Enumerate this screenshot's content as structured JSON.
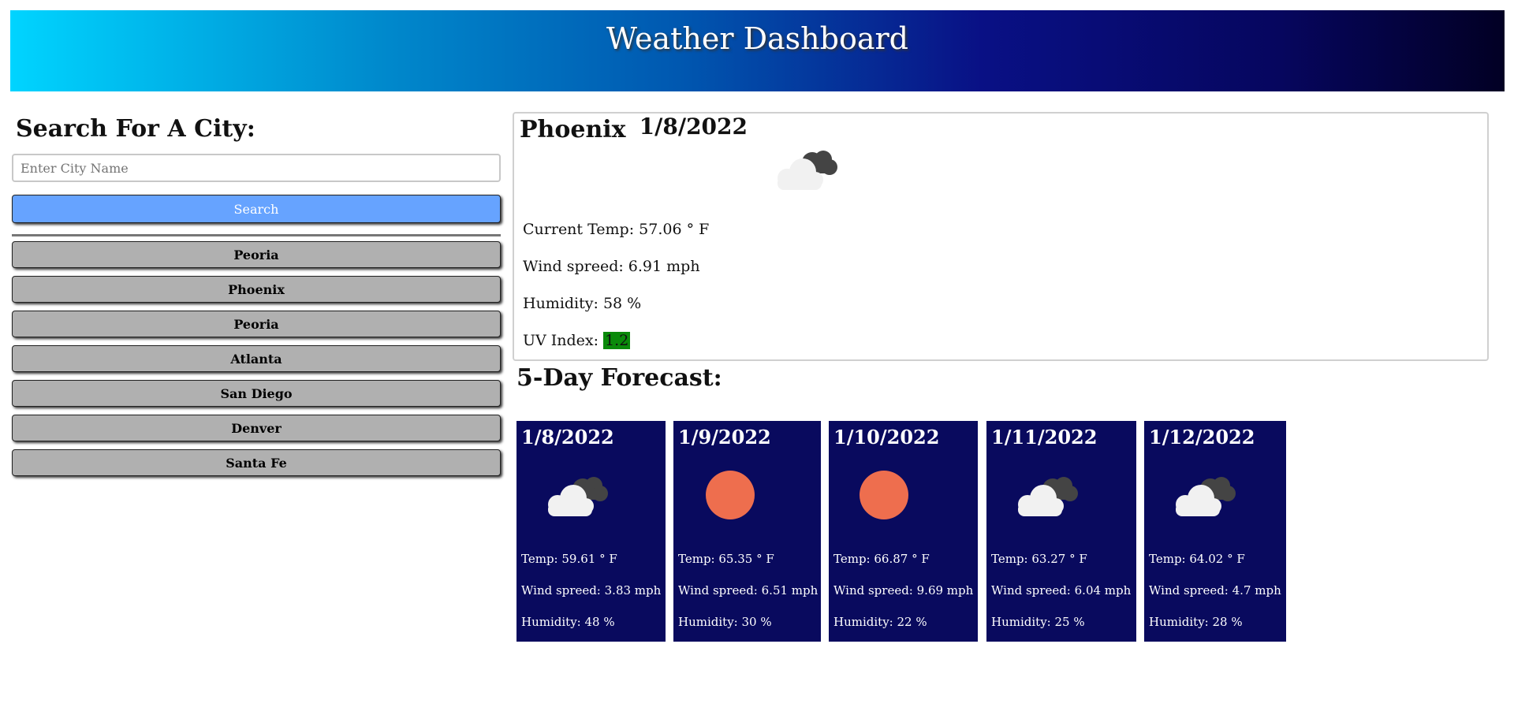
{
  "header": {
    "title": "Weather Dashboard"
  },
  "search": {
    "title": "Search For A City:",
    "placeholder": "Enter City Name",
    "value": "",
    "button_label": "Search"
  },
  "history": [
    "Peoria",
    "Phoenix",
    "Peoria",
    "Atlanta",
    "San Diego",
    "Denver",
    "Santa Fe"
  ],
  "current": {
    "city": "Phoenix",
    "date": "1/8/2022",
    "icon": "clouds-icon",
    "temp": "Current Temp: 57.06 ° F",
    "wind": "Wind spreed: 6.91 mph",
    "humidity": "Humidity: 58 %",
    "uv_label": "UV Index:",
    "uv_value": "1.2",
    "uv_color": "#0a8a0a"
  },
  "forecast": {
    "title": "5-Day Forecast:",
    "days": [
      {
        "date": "1/8/2022",
        "icon": "clouds-icon",
        "temp": "Temp: 59.61 ° F",
        "wind": "Wind spreed: 3.83 mph",
        "humidity": "Humidity: 48 %"
      },
      {
        "date": "1/9/2022",
        "icon": "sun-icon",
        "temp": "Temp: 65.35 ° F",
        "wind": "Wind spreed: 6.51 mph",
        "humidity": "Humidity: 30 %"
      },
      {
        "date": "1/10/2022",
        "icon": "sun-icon",
        "temp": "Temp: 66.87 ° F",
        "wind": "Wind spreed: 9.69 mph",
        "humidity": "Humidity: 22 %"
      },
      {
        "date": "1/11/2022",
        "icon": "clouds-icon",
        "temp": "Temp: 63.27 ° F",
        "wind": "Wind spreed: 6.04 mph",
        "humidity": "Humidity: 25 %"
      },
      {
        "date": "1/12/2022",
        "icon": "clouds-icon",
        "temp": "Temp: 64.02 ° F",
        "wind": "Wind spreed: 4.7 mph",
        "humidity": "Humidity: 28 %"
      }
    ]
  },
  "colors": {
    "header_gradient_start": "#00d4ff",
    "header_gradient_end": "#020024",
    "search_button": "#66a3ff",
    "history_button": "#b0b0b0",
    "forecast_card": "#090a5e",
    "sun": "#ee6e4e"
  }
}
